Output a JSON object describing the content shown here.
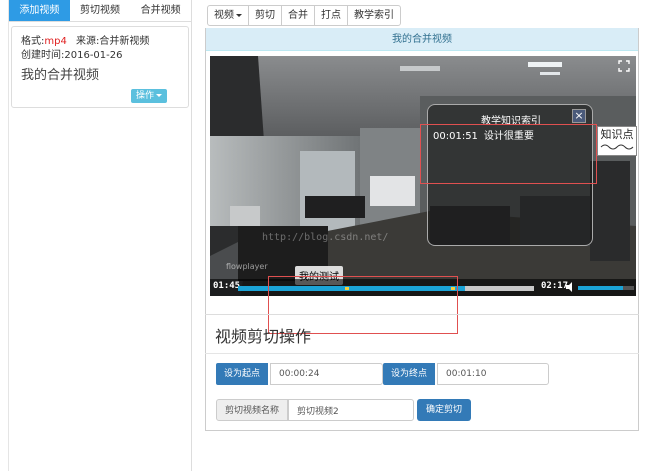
{
  "left": {
    "tabs": [
      {
        "label": "添加视频",
        "active": true
      },
      {
        "label": "剪切视频",
        "active": false
      },
      {
        "label": "合并视频",
        "active": false
      }
    ],
    "card": {
      "format_label": "格式:",
      "format_value": "mp4",
      "source_label": "来源:",
      "source_value": "合并新视频",
      "created_label": "创建时间:",
      "created_value": "2016-01-26",
      "title": "我的合并视频",
      "op_button": "操作"
    }
  },
  "toolbar": {
    "items": [
      {
        "label": "视频",
        "dropdown": true
      },
      {
        "label": "剪切"
      },
      {
        "label": "合并"
      },
      {
        "label": "打点"
      },
      {
        "label": "教学索引"
      }
    ]
  },
  "panel": {
    "title": "我的合并视频"
  },
  "player": {
    "current_time": "01:45",
    "total_time": "02:17",
    "progress": 0.767,
    "cue_points": [
      0.36,
      0.72
    ],
    "volume": 0.8,
    "brand": "flowplayer",
    "watermark": "http://blog.csdn.net/",
    "caption": "我的测试",
    "knowledge_popup": {
      "title": "教学知识索引",
      "close": "×",
      "entries": [
        {
          "time": "00:01:51",
          "text": "设计很重要"
        }
      ]
    },
    "knowledge_tab": "知识点"
  },
  "clip": {
    "title": "视频剪切操作",
    "start_button": "设为起点",
    "start_value": "00:00:24",
    "end_button": "设为终点",
    "end_value": "00:01:10",
    "name_label": "剪切视频名称",
    "name_value": "剪切视频2",
    "confirm_button": "确定剪切"
  },
  "colors": {
    "tab_active": "#2e9be5",
    "panel_head_bg": "#d9edf7",
    "panel_head_text": "#31708f",
    "primary": "#337ab7",
    "info_button": "#5bc0de",
    "format_red": "#e02020",
    "progress_fill": "#1ba3d6",
    "annotation_red": "#e05050"
  }
}
